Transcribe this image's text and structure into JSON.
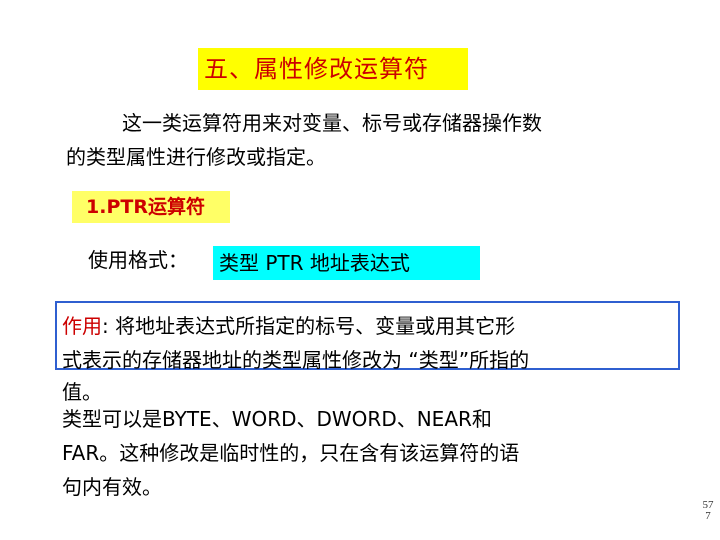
{
  "slide": {
    "title": "五、属性修改运算符",
    "intro_line1": "这一类运算符用来对变量、标号或存储器操作数",
    "intro_line2": "的类型属性进行修改或指定。",
    "section_heading": "1.PTR运算符",
    "format_label": "使用格式：",
    "format_value": "类型   PTR   地址表达式",
    "effect_label": "作用",
    "effect_line1_rest": ": 将地址表达式所指定的标号、变量或用其它形",
    "effect_line2": "式表示的存储器地址的类型属性修改为 “类型”所指的",
    "effect_line3": "值。",
    "type_line1": "类型可以是BYTE、WORD、DWORD、NEAR和",
    "type_line2": "FAR。这种修改是临时性的，只在含有该运算符的语",
    "type_line3": "句内有效。",
    "page_number": "577"
  },
  "colors": {
    "title_bg": "#ffff00",
    "title_text": "#cc0000",
    "section_bg": "#ffff66",
    "format_bg": "#00ffff",
    "effect_border": "#2f5fd0",
    "accent_red": "#cc0000"
  }
}
